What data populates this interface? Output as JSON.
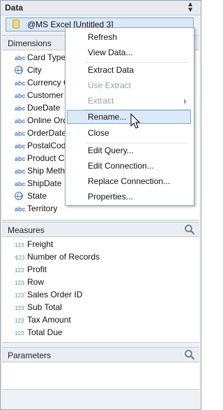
{
  "data_pane": {
    "title": "Data",
    "sort_icon": "sort-icon",
    "data_source": "@MS Excel [Untitled 3]"
  },
  "dimensions": {
    "title": "Dimensions",
    "items": [
      {
        "icon": "abc",
        "label": "Card Type"
      },
      {
        "icon": "globe",
        "label": "City"
      },
      {
        "icon": "abc",
        "label": "Currency C"
      },
      {
        "icon": "abc",
        "label": "Customer N"
      },
      {
        "icon": "abc",
        "label": "DueDate"
      },
      {
        "icon": "abc",
        "label": "Online Ord"
      },
      {
        "icon": "abc",
        "label": "OrderDate"
      },
      {
        "icon": "abc",
        "label": "PostalCode"
      },
      {
        "icon": "abc",
        "label": "Product Ca"
      },
      {
        "icon": "abc",
        "label": "Ship Metho"
      },
      {
        "icon": "abc",
        "label": "ShipDate"
      },
      {
        "icon": "globe",
        "label": "State"
      },
      {
        "icon": "abc",
        "label": "Territory"
      }
    ]
  },
  "measures": {
    "title": "Measures",
    "items": [
      {
        "icon": "123",
        "label": "Freight"
      },
      {
        "icon": "calc-123",
        "label": "Number of Records"
      },
      {
        "icon": "123",
        "label": "Profit"
      },
      {
        "icon": "123",
        "label": "Row"
      },
      {
        "icon": "123",
        "label": "Sales Order ID"
      },
      {
        "icon": "123",
        "label": "Sub Total"
      },
      {
        "icon": "123",
        "label": "Tax Amount"
      },
      {
        "icon": "123",
        "label": "Total Due"
      }
    ]
  },
  "parameters": {
    "title": "Parameters"
  },
  "context_menu": {
    "items": [
      {
        "label": "Refresh",
        "enabled": true
      },
      {
        "label": "View Data...",
        "enabled": true
      },
      {
        "label": "Extract Data",
        "enabled": true
      },
      {
        "label": "Use Extract",
        "enabled": false
      },
      {
        "label": "Extract",
        "enabled": false,
        "submenu": true
      },
      {
        "label": "Rename...",
        "enabled": true,
        "highlighted": true
      },
      {
        "label": "Close",
        "enabled": true
      },
      {
        "label": "Edit Query...",
        "enabled": true
      },
      {
        "label": "Edit Connection...",
        "enabled": true
      },
      {
        "label": "Replace Connection...",
        "enabled": true
      },
      {
        "label": "Properties...",
        "enabled": true
      }
    ]
  },
  "icon_texts": {
    "abc": "abc",
    "num": "123",
    "calc": "="
  },
  "colors": {
    "selection_fill": "#dce9f8",
    "selection_border": "#7ea6d6",
    "dimension_icon": "#4b7cc2",
    "measure_icon": "#4aa37a"
  }
}
